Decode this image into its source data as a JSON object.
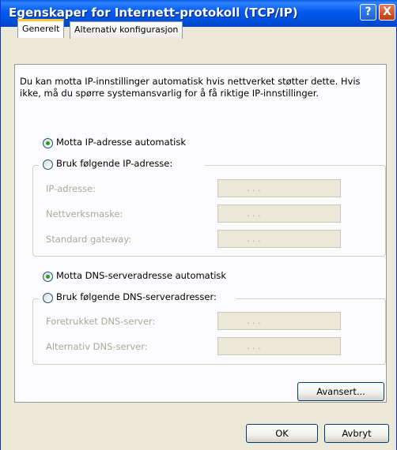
{
  "window": {
    "title": "Egenskaper for Internett-protokoll (TCP/IP)",
    "help_label": "?",
    "close_label": "X"
  },
  "tabs": [
    {
      "label": "Generelt",
      "active": true
    },
    {
      "label": "Alternativ konfigurasjon",
      "active": false
    }
  ],
  "intro_text": "Du kan motta IP-innstillinger automatisk hvis nettverket støtter dette. Hvis ikke, må du spørre systemansvarlig for å få riktige IP-innstillinger.",
  "ip_section": {
    "auto_label": "Motta IP-adresse automatisk",
    "auto_selected": true,
    "manual_label": "Bruk følgende IP-adresse:",
    "fields": [
      {
        "label": "IP-adresse:",
        "dots": ".   .   ."
      },
      {
        "label": "Nettverksmaske:",
        "dots": ".   .   ."
      },
      {
        "label": "Standard gateway:",
        "dots": ".   .   ."
      }
    ]
  },
  "dns_section": {
    "auto_label": "Motta DNS-serveradresse automatisk",
    "auto_selected": true,
    "manual_label": "Bruk følgende DNS-serveradresser:",
    "fields": [
      {
        "label": "Foretrukket DNS-server:",
        "dots": ".   .   ."
      },
      {
        "label": "Alternativ DNS-server:",
        "dots": ".   .   ."
      }
    ]
  },
  "buttons": {
    "advanced": "Avansert...",
    "ok": "OK",
    "cancel": "Avbryt"
  }
}
